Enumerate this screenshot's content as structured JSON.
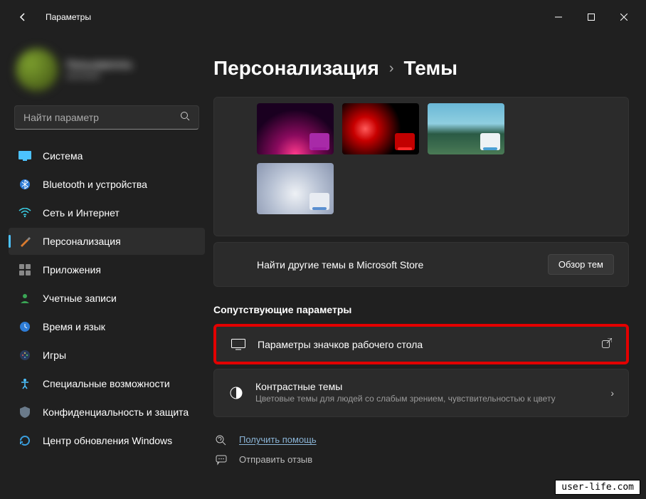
{
  "titlebar": {
    "app_name": "Параметры"
  },
  "account": {
    "name": "Пользователь",
    "email": "account"
  },
  "search": {
    "placeholder": "Найти параметр"
  },
  "sidebar": {
    "items": [
      {
        "label": "Система",
        "icon": "🖥️",
        "color": "#4cc2ff"
      },
      {
        "label": "Bluetooth и устройства",
        "icon": "bt"
      },
      {
        "label": "Сеть и Интернет",
        "icon": "wifi"
      },
      {
        "label": "Персонализация",
        "icon": "brush",
        "active": true
      },
      {
        "label": "Приложения",
        "icon": "apps"
      },
      {
        "label": "Учетные записи",
        "icon": "user"
      },
      {
        "label": "Время и язык",
        "icon": "clock"
      },
      {
        "label": "Игры",
        "icon": "games"
      },
      {
        "label": "Специальные возможности",
        "icon": "access"
      },
      {
        "label": "Конфиденциальность и защита",
        "icon": "shield"
      },
      {
        "label": "Центр обновления Windows",
        "icon": "update"
      }
    ]
  },
  "breadcrumb": {
    "root": "Персонализация",
    "current": "Темы"
  },
  "store": {
    "text": "Найти другие темы в Microsoft Store",
    "button": "Обзор тем"
  },
  "section_related": "Сопутствующие параметры",
  "rows": {
    "desktop_icons": {
      "title": "Параметры значков рабочего стола"
    },
    "contrast": {
      "title": "Контрастные темы",
      "sub": "Цветовые темы для людей со слабым зрением, чувствительностью к цвету"
    }
  },
  "footer": {
    "help": "Получить помощь",
    "feedback": "Отправить отзыв"
  },
  "watermark": "user-life.com"
}
